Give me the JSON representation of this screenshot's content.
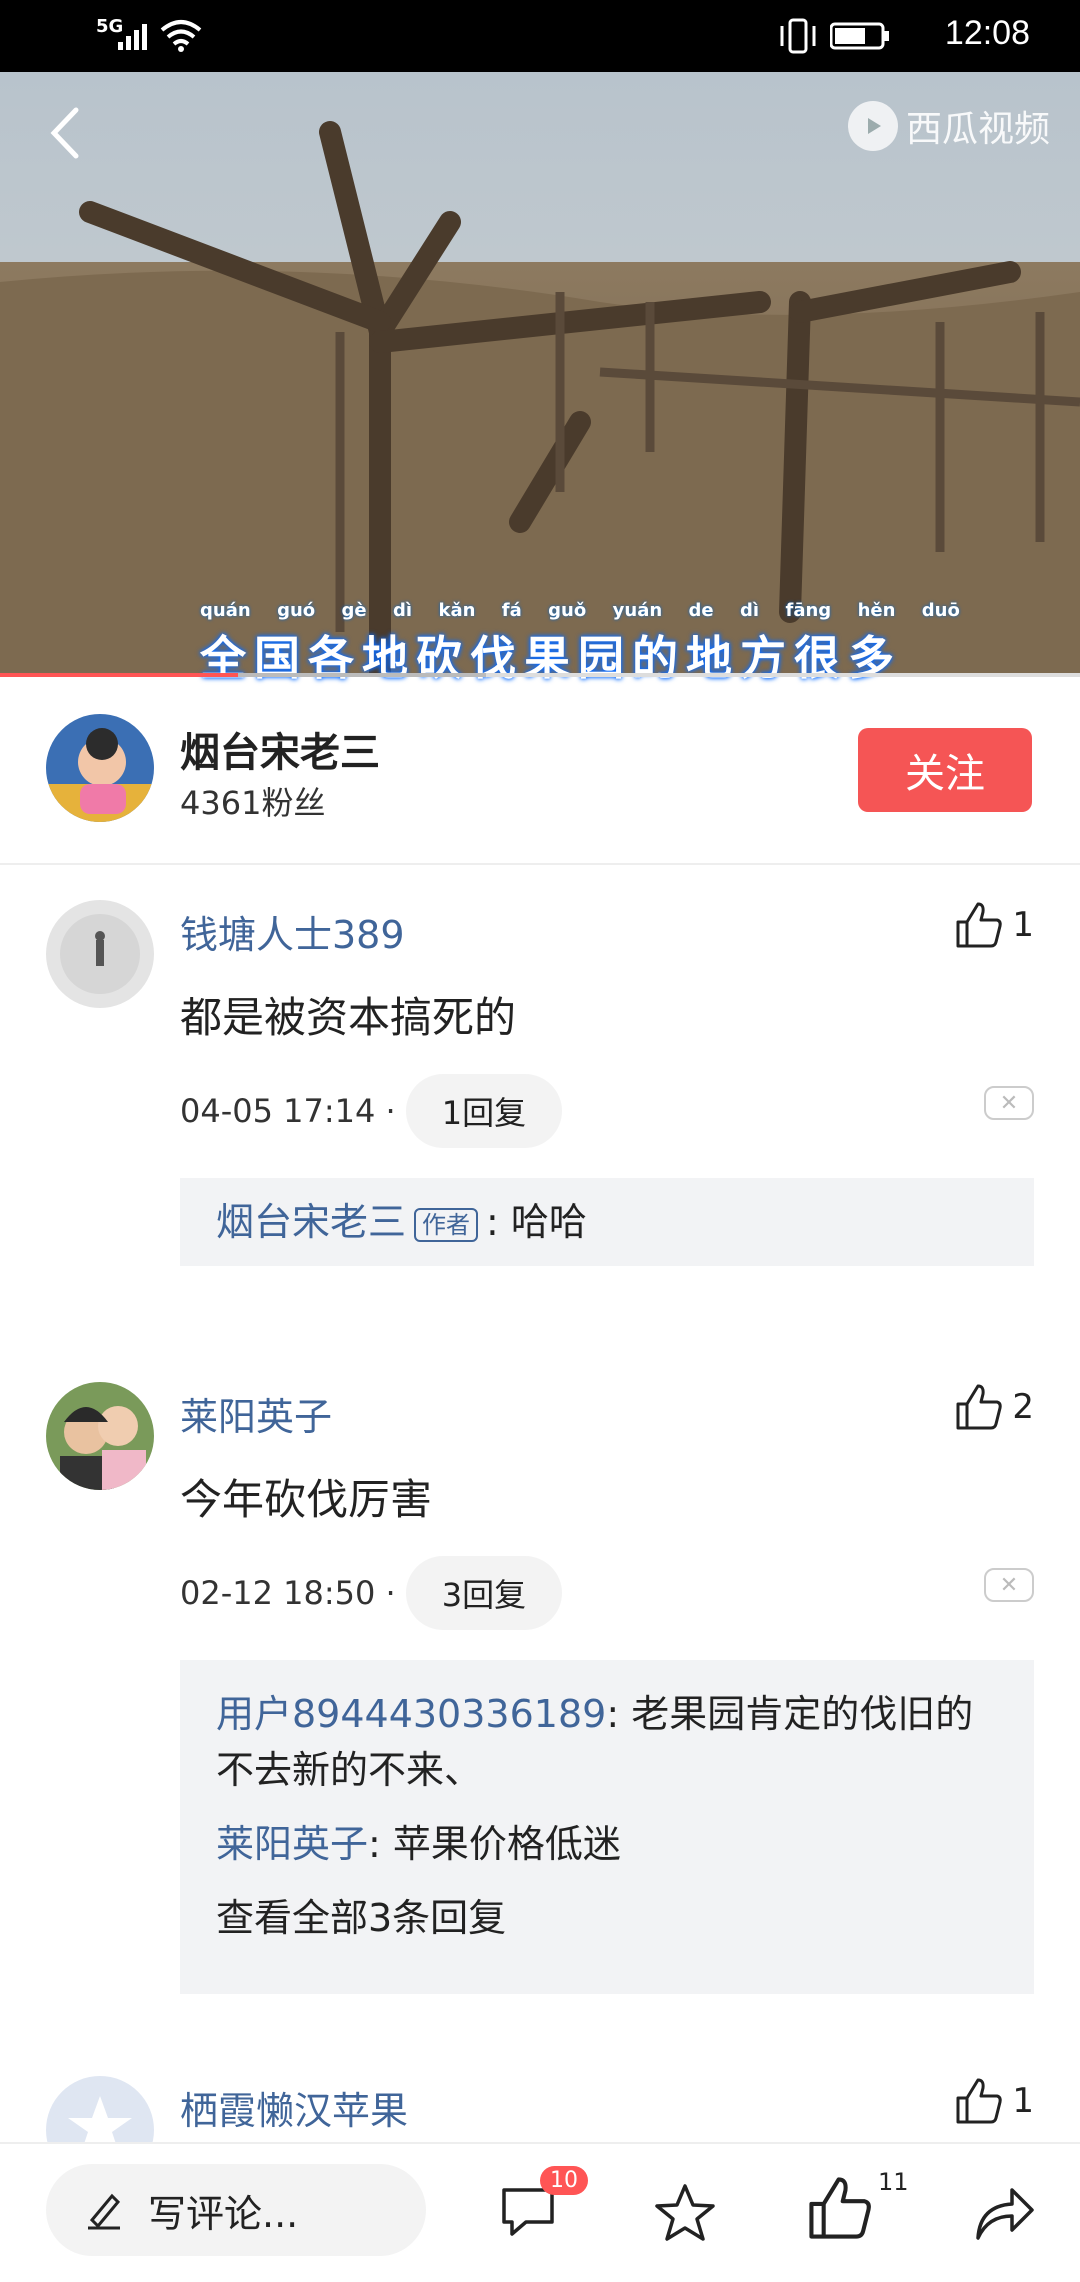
{
  "status_bar": {
    "signal": "5G",
    "time": "12:08"
  },
  "video": {
    "brand": "西瓜视频",
    "subtitle": "全国各地砍伐果园的地方很多",
    "pinyin": [
      "quán",
      "guó",
      "gè",
      "dì",
      "kǎn",
      "fá",
      "guǒ",
      "yuán",
      "de",
      "dì",
      "fāng",
      "hěn",
      "duō"
    ],
    "progress": 0.22,
    "buffered": 0.45
  },
  "author": {
    "name": "烟台宋老三",
    "fans": "4361粉丝",
    "follow_label": "关注"
  },
  "comments": [
    {
      "user": "钱塘人士389",
      "likes": "1",
      "text": "都是被资本搞死的",
      "time": "04-05 17:14 ·",
      "replies_label": "1回复",
      "replies": [
        {
          "user": "烟台宋老三",
          "tag": "作者",
          "text": ": 哈哈"
        }
      ]
    },
    {
      "user": "莱阳英子",
      "likes": "2",
      "text": "今年砍伐厉害",
      "time": "02-12 18:50 ·",
      "replies_label": "3回复",
      "replies": [
        {
          "user": "用户8944430336189",
          "text": ": 老果园肯定的伐旧的不去新的不来、"
        },
        {
          "user": "莱阳英子",
          "text": ": 苹果价格低迷"
        }
      ],
      "more_label": "查看全部3条回复"
    },
    {
      "user": "栖霞懒汉苹果",
      "likes": "1"
    }
  ],
  "bottom_bar": {
    "input_placeholder": "写评论...",
    "comment_count": "10",
    "like_count": "11"
  }
}
